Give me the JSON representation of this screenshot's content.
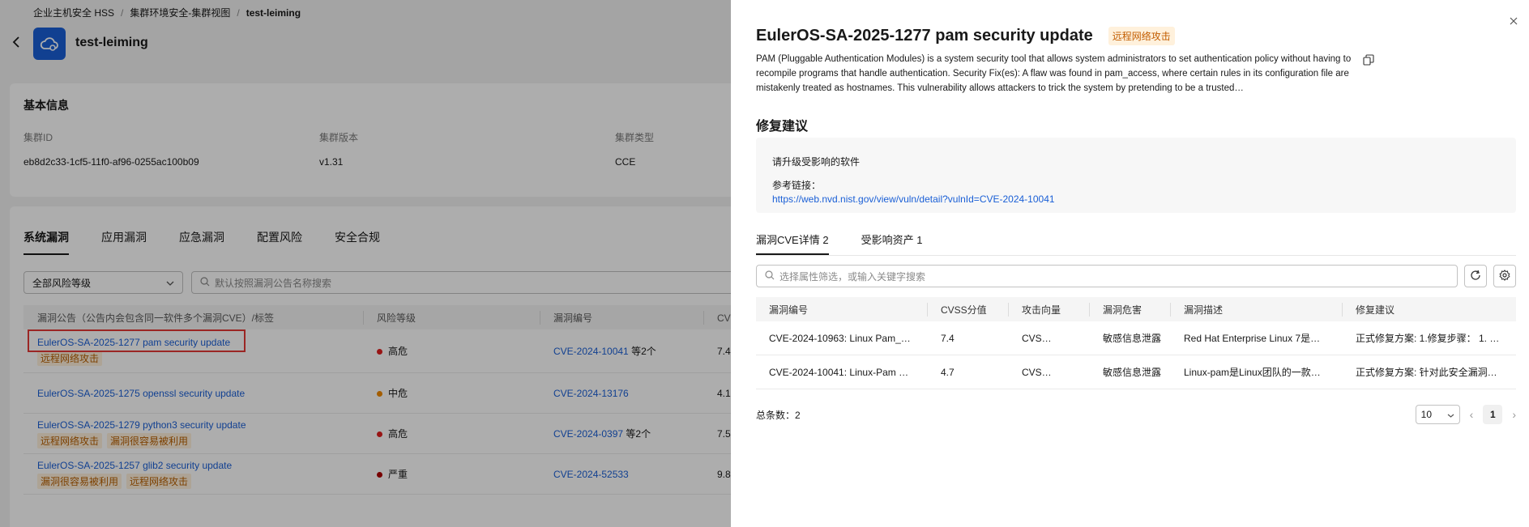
{
  "breadcrumb": [
    "企业主机安全 HSS",
    "集群环境安全-集群视图",
    "test-leiming"
  ],
  "page_title": "test-leiming",
  "basic_info": {
    "title": "基本信息",
    "items": [
      {
        "label": "集群ID",
        "value": "eb8d2c33-1cf5-11f0-af96-0255ac100b09"
      },
      {
        "label": "集群版本",
        "value": "v1.31"
      },
      {
        "label": "集群类型",
        "value": "CCE"
      }
    ]
  },
  "list_tabs": [
    "系统漏洞",
    "应用漏洞",
    "应急漏洞",
    "配置风险",
    "安全合规"
  ],
  "filter": {
    "select_value": "全部风险等级",
    "search_placeholder": "默认按照漏洞公告名称搜索"
  },
  "vuln_table": {
    "headers": [
      "漏洞公告（公告内会包含同一软件多个漏洞CVE）/标签",
      "风险等级",
      "漏洞编号",
      "CVSS评"
    ],
    "rows": [
      {
        "name": "EulerOS-SA-2025-1277 pam security update",
        "tags": [
          "远程网络攻击"
        ],
        "risk": "高危",
        "risk_color": "#e02020",
        "cve": "CVE-2024-10041",
        "more": "等2个",
        "cvss": "7.4"
      },
      {
        "name": "EulerOS-SA-2025-1275 openssl security update",
        "tags": [],
        "risk": "中危",
        "risk_color": "#f08a00",
        "cve": "CVE-2024-13176",
        "more": "",
        "cvss": "4.1"
      },
      {
        "name": "EulerOS-SA-2025-1279 python3 security update",
        "tags": [
          "远程网络攻击",
          "漏洞很容易被利用"
        ],
        "risk": "高危",
        "risk_color": "#e02020",
        "cve": "CVE-2024-0397",
        "more": "等2个",
        "cvss": "7.5"
      },
      {
        "name": "EulerOS-SA-2025-1257 glib2 security update",
        "tags": [
          "漏洞很容易被利用",
          "远程网络攻击"
        ],
        "risk": "严重",
        "risk_color": "#b00000",
        "cve": "CVE-2024-52533",
        "more": "",
        "cvss": "9.8"
      }
    ]
  },
  "drawer": {
    "title": "EulerOS-SA-2025-1277 pam security update",
    "tag": "远程网络攻击",
    "description": "PAM (Pluggable Authentication Modules) is a system security tool that allows system administrators to set authentication policy without having to recompile programs that handle authentication. Security Fix(es): A flaw was found in pam_access, where certain rules in its configuration file are mistakenly treated as hostnames. This vulnerability allows attackers to trick the system by pretending to be a trusted…",
    "advice_title": "修复建议",
    "advice_text": "请升级受影响的软件",
    "ref_label": "参考链接：",
    "ref_link": "https://web.nvd.nist.gov/view/vuln/detail?vulnId=CVE-2024-10041",
    "tabs": [
      {
        "label": "漏洞CVE详情",
        "count": "2"
      },
      {
        "label": "受影响资产",
        "count": "1"
      }
    ],
    "search_placeholder": "选择属性筛选，或输入关键字搜索",
    "table": {
      "headers": [
        "漏洞编号",
        "CVSS分值",
        "攻击向量",
        "漏洞危害",
        "漏洞描述",
        "修复建议"
      ],
      "rows": [
        [
          "CVE-2024-10963: Linux Pam_…",
          "7.4",
          "CVS…",
          "敏感信息泄露",
          "Red Hat Enterprise Linux 7是…",
          "正式修复方案: 1.修复步骤： 1. …"
        ],
        [
          "CVE-2024-10041: Linux-Pam …",
          "4.7",
          "CVS…",
          "敏感信息泄露",
          "Linux-pam是Linux团队的一款…",
          "正式修复方案: 针对此安全漏洞…"
        ]
      ]
    },
    "total_label": "总条数：2",
    "page_size": "10",
    "current_page": "1"
  },
  "colors": {
    "link": "#1a5fd6",
    "tag_bg": "#fff1dc",
    "tag_text": "#c25d00",
    "highlight": "#e53935"
  }
}
